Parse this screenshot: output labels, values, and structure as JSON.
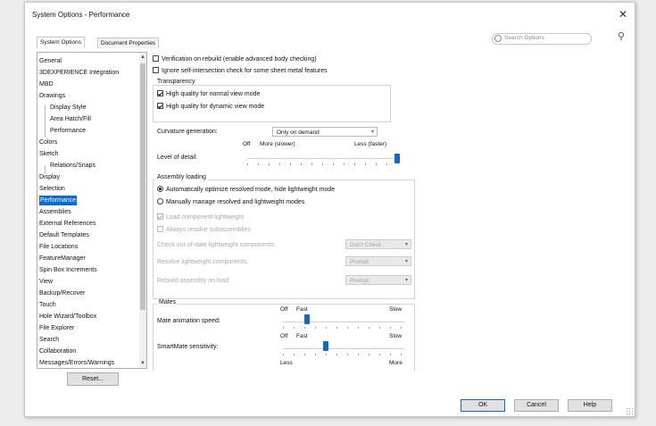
{
  "window": {
    "title": "System Options - Performance"
  },
  "tabs": [
    {
      "label": "System Options"
    },
    {
      "label": "Document Properties"
    }
  ],
  "search": {
    "placeholder": "Search Options"
  },
  "tree": {
    "items": [
      {
        "label": "General"
      },
      {
        "label": "3DEXPERIENCE Integration"
      },
      {
        "label": "MBD"
      },
      {
        "label": "Drawings"
      },
      {
        "label": "Display Style"
      },
      {
        "label": "Area Hatch/Fill"
      },
      {
        "label": "Performance"
      },
      {
        "label": "Colors"
      },
      {
        "label": "Sketch"
      },
      {
        "label": "Relations/Snaps"
      },
      {
        "label": "Display"
      },
      {
        "label": "Selection"
      },
      {
        "label": "Performance"
      },
      {
        "label": "Assemblies"
      },
      {
        "label": "External References"
      },
      {
        "label": "Default Templates"
      },
      {
        "label": "File Locations"
      },
      {
        "label": "FeatureManager"
      },
      {
        "label": "Spin Box Increments"
      },
      {
        "label": "View"
      },
      {
        "label": "Backup/Recover"
      },
      {
        "label": "Touch"
      },
      {
        "label": "Hole Wizard/Toolbox"
      },
      {
        "label": "File Explorer"
      },
      {
        "label": "Search"
      },
      {
        "label": "Collaboration"
      },
      {
        "label": "Messages/Errors/Warnings"
      }
    ]
  },
  "reset_label": "Reset...",
  "options": {
    "verification_rebuild": "Verification on rebuild (enable advanced body checking)",
    "ignore_self_intersection": "Ignore self-intersection check for some sheet metal features",
    "transparency": {
      "title": "Transparency",
      "normal": "High quality for normal view mode",
      "dynamic": "High quality for dynamic view mode"
    },
    "curvature": {
      "label": "Curvature generation:",
      "value": "Only on demand"
    },
    "level_of_detail": {
      "label": "Level of detail:",
      "off": "Off",
      "more": "More (slower)",
      "less": "Less (faster)",
      "value": 1.0
    },
    "assembly_loading": {
      "title": "Assembly loading",
      "auto": "Automatically optimize resolved mode, hide lightweight mode",
      "manual": "Manually manage resolved and lightweight modes",
      "load_lightweight": "Load component lightweight",
      "always_resolve": "Always resolve subassemblies",
      "check_outdated": {
        "label": "Check out-of-date lightweight components:",
        "value": "Don't Check"
      },
      "resolve_lightweight": {
        "label": "Resolve lightweight components:",
        "value": "Prompt"
      },
      "rebuild_on_load": {
        "label": "Rebuild assembly on load:",
        "value": "Prompt"
      }
    },
    "mates": {
      "title": "Mates",
      "animation": {
        "label": "Mate animation speed:",
        "off": "Off",
        "fast": "Fast",
        "slow": "Slow",
        "value": 0.2
      },
      "smartmate": {
        "label": "SmartMate sensitivity:",
        "off": "Off",
        "fast": "Fast",
        "slow": "Slow",
        "value": 0.35
      },
      "third": {
        "less": "Less",
        "more": "More"
      }
    }
  },
  "buttons": {
    "ok": "OK",
    "cancel": "Cancel",
    "help": "Help"
  }
}
